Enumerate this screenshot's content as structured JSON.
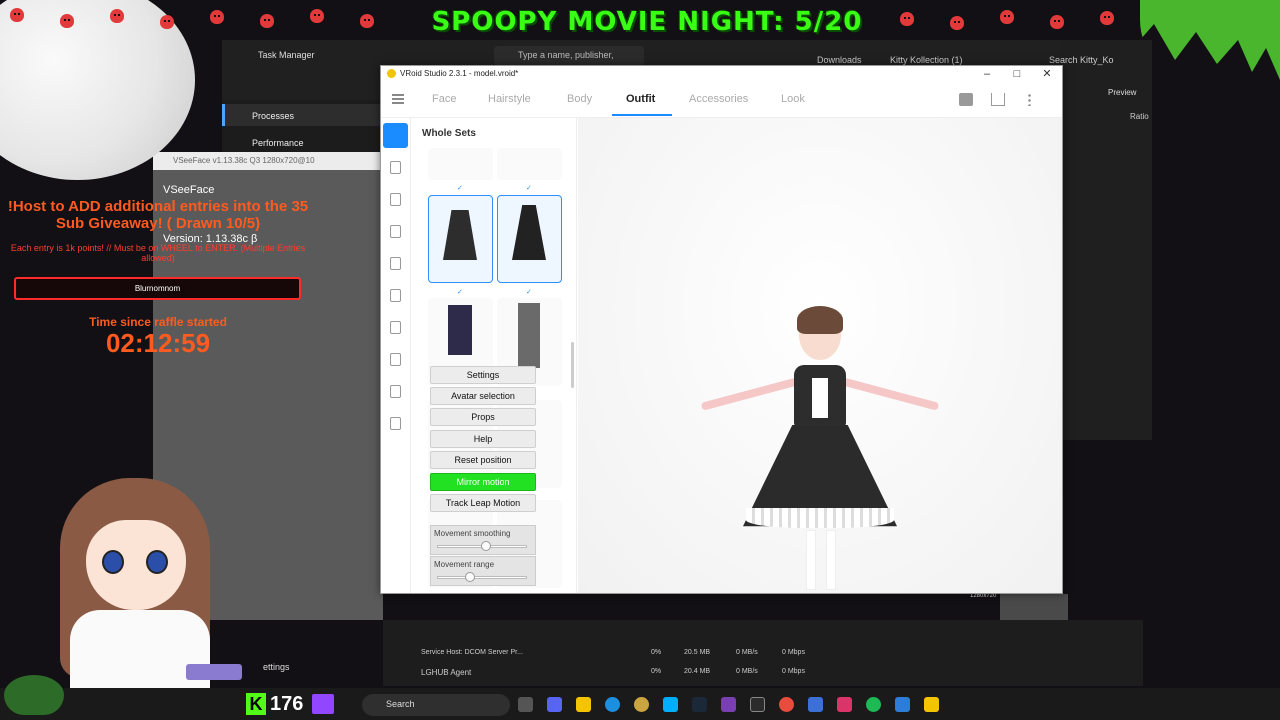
{
  "overlay": {
    "banner": "SPOOPY MOVIE NIGHT: 5/20",
    "raffle_title": "!Host to ADD additional entries into the 35 Sub Giveaway! ( Drawn 10/5)",
    "raffle_sub": "Each entry is 1k points! // Must be on WHEEL to ENTER. (Multiple Entries allowed)",
    "raffle_winner": "Blurnomnom",
    "raffle_time_label": "Time since raffle started",
    "raffle_time": "02:12:59"
  },
  "task_manager": {
    "title": "Task Manager",
    "search_placeholder": "Type a name, publisher,",
    "nav": [
      "Processes",
      "Performance"
    ],
    "rows": [
      {
        "name": "Service Host: DCOM Server Pr...",
        "cpu": "0%",
        "mem": "20.5 MB",
        "disk": "0 MB/s",
        "net": "0 Mbps"
      },
      {
        "name": "LGHUB Agent",
        "cpu": "0%",
        "mem": "20.4 MB",
        "disk": "0 MB/s",
        "net": "0 Mbps"
      }
    ]
  },
  "explorer": {
    "breadcrumb": [
      "Downloads",
      "Kitty Kollection (1)"
    ],
    "search": "Search Kitty_Ko",
    "preview": "Preview",
    "ratio": "Ratio"
  },
  "vseeface": {
    "window_title": "VSeeFace v1.13.38c Q3 1280x720@10",
    "name": "VSeeFace",
    "version": "Version: 1.13.38c β",
    "menu": [
      "Settings",
      "Avatar selection",
      "Props",
      "Help",
      "Reset position",
      "Mirror motion",
      "Track Leap Motion"
    ],
    "sliders": [
      {
        "label": "Movement smoothing",
        "value": 0.55
      },
      {
        "label": "Movement range",
        "value": 0.35
      }
    ],
    "resolution": "1280x720"
  },
  "vroid": {
    "title": "VRoid Studio 2.3.1 - model.vroid*",
    "tabs": [
      "Face",
      "Hairstyle",
      "Body",
      "Outfit",
      "Accessories",
      "Look"
    ],
    "active_tab": "Outfit",
    "panel_title": "Whole Sets",
    "accent": "#1a8cff"
  },
  "taskbar": {
    "viewer_count": "176",
    "search": "Search",
    "settings_label": "ettings"
  }
}
